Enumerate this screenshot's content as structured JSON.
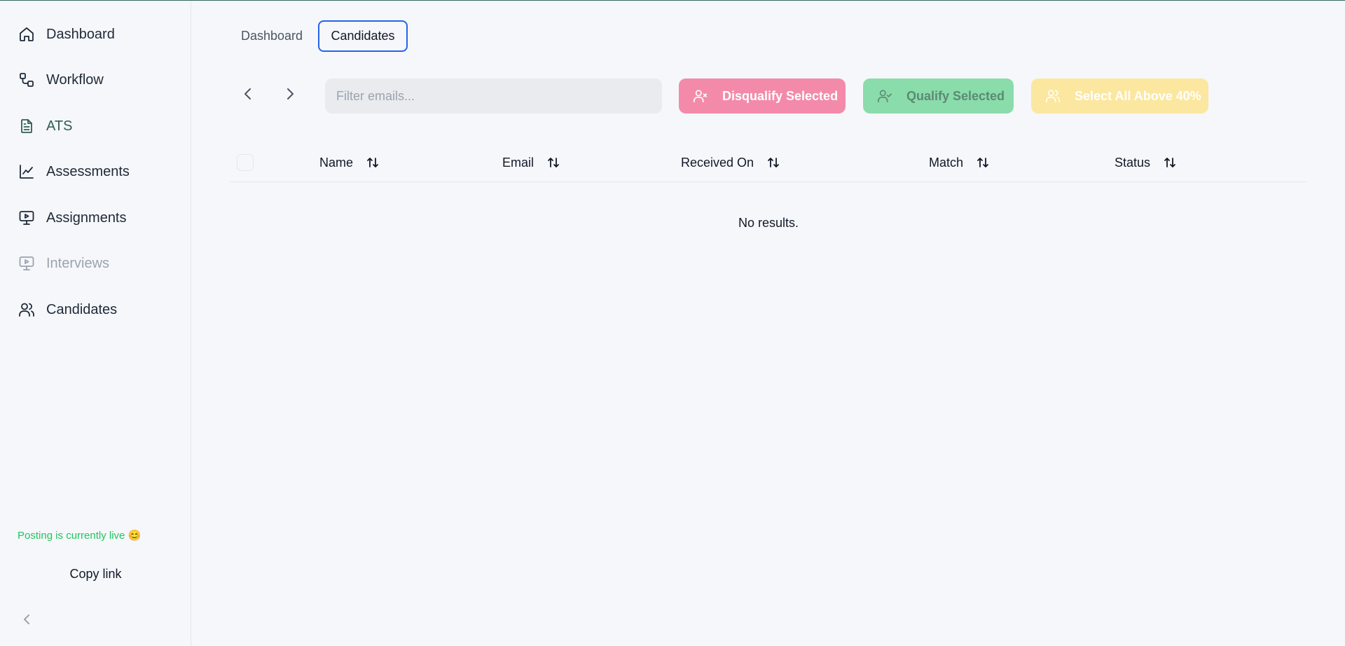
{
  "sidebar": {
    "items": [
      {
        "label": "Dashboard",
        "icon": "home-icon"
      },
      {
        "label": "Workflow",
        "icon": "workflow-icon"
      },
      {
        "label": "ATS",
        "icon": "file-text-icon"
      },
      {
        "label": "Assessments",
        "icon": "line-chart-icon"
      },
      {
        "label": "Assignments",
        "icon": "monitor-play-icon"
      },
      {
        "label": "Interviews",
        "icon": "monitor-play-icon"
      },
      {
        "label": "Candidates",
        "icon": "users-icon"
      }
    ],
    "status": "Posting is currently live 😊",
    "copy_link": "Copy link"
  },
  "tabs": [
    {
      "label": "Dashboard"
    },
    {
      "label": "Candidates"
    }
  ],
  "toolbar": {
    "filter_placeholder": "Filter emails...",
    "disqualify_label": "Disqualify Selected",
    "qualify_label": "Qualify Selected",
    "select_above_label": "Select All Above 40%"
  },
  "table": {
    "columns": [
      "Name",
      "Email",
      "Received On",
      "Match",
      "Status"
    ],
    "empty_message": "No results."
  },
  "colors": {
    "accent": "#2f5d4f",
    "disqualify": "#f48aa9",
    "qualify": "#8adcab",
    "select_above": "#fce7a0",
    "live": "#22c55e",
    "tab_focus": "#2563eb"
  }
}
